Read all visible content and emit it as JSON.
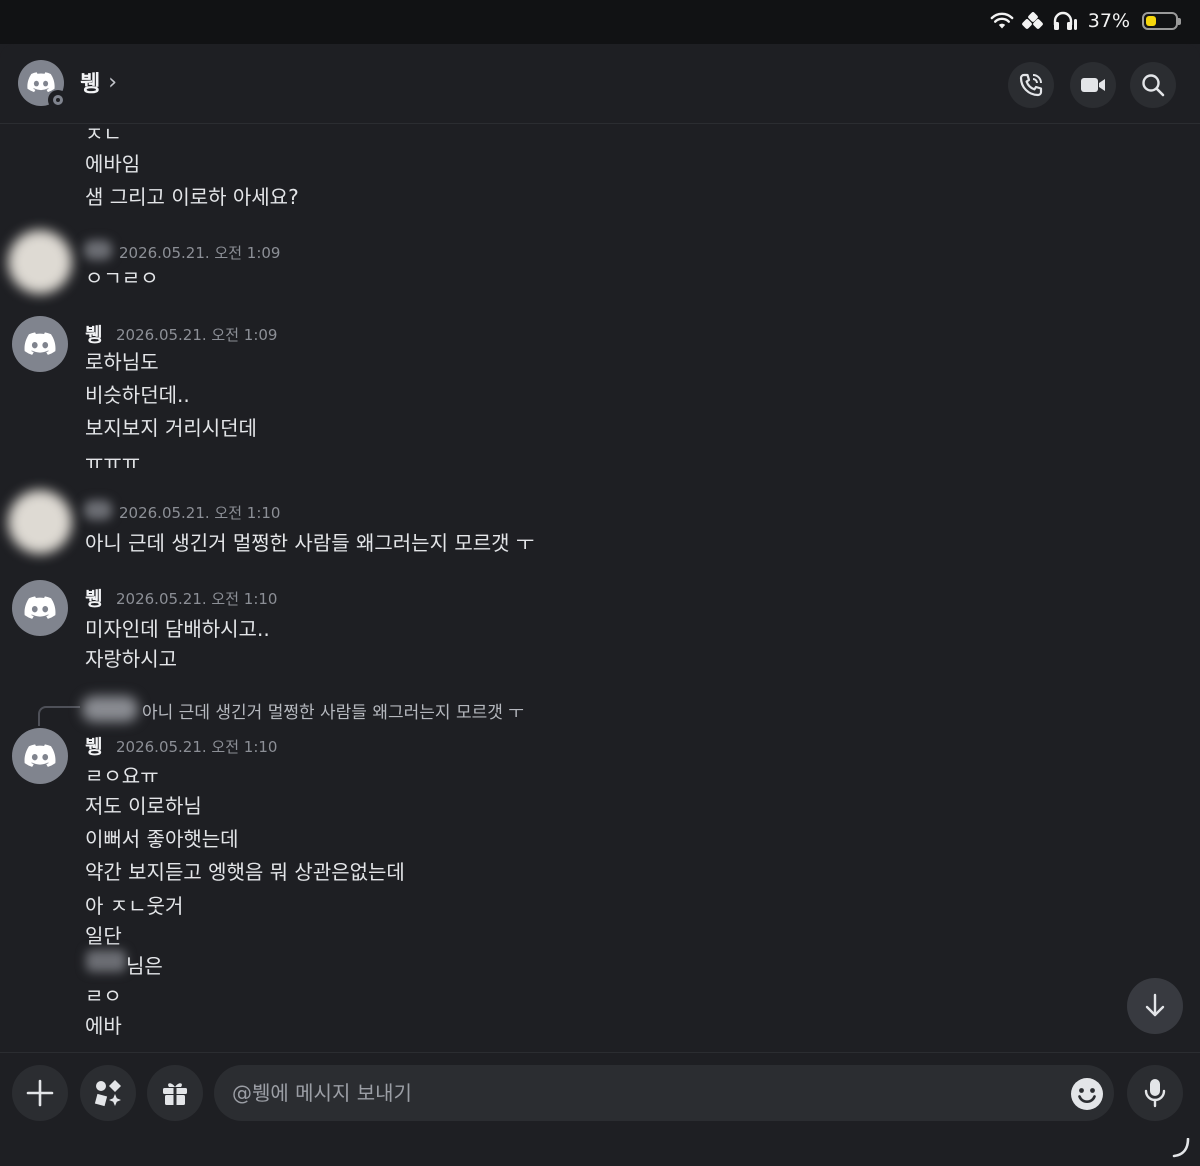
{
  "status_bar": {
    "battery_percent": "37%",
    "battery_level": 0.37,
    "battery_color": "#f5d60c",
    "icons": [
      "wifi-icon",
      "link-icon",
      "headphones-icon",
      "battery-icon"
    ]
  },
  "header": {
    "channel_name": "뷍",
    "chevron": "›",
    "buttons": [
      "voice-call-icon",
      "video-call-icon",
      "search-icon"
    ]
  },
  "messages": {
    "group0": {
      "lines": [
        "ㅈㄴ",
        "에바임",
        "샘 그리고 이로하 아세요?"
      ]
    },
    "group1": {
      "timestamp": "2026.05.21. 오전 1:09",
      "lines": [
        "ㅇㄱㄹㅇ"
      ]
    },
    "group2": {
      "author": "뷍",
      "timestamp": "2026.05.21. 오전 1:09",
      "lines": [
        "로하님도",
        "비슷하던데..",
        "보지보지 거리시던데",
        "ㅠㅠㅠ"
      ]
    },
    "group3": {
      "timestamp": "2026.05.21. 오전 1:10",
      "lines": [
        "아니 근데 생긴거 멀쩡한 사람들 왜그러는지 모르갯 ㅜ"
      ]
    },
    "group4": {
      "author": "뷍",
      "timestamp": "2026.05.21. 오전 1:10",
      "lines": [
        "미자인데 담배하시고..",
        "자랑하시고"
      ]
    },
    "group5": {
      "reply_preview": "아니 근데 생긴거 멀쩡한 사람들 왜그러는지 모르갯 ㅜ",
      "author": "뷍",
      "timestamp": "2026.05.21. 오전 1:10",
      "lines": [
        "ㄹㅇ요ㅠ",
        "저도 이로하님",
        "이뻐서 좋아햇는데",
        "약간 보지듣고 엥햇음 뭐 상관은없는데",
        "아 ㅈㄴ웃거",
        "일단",
        "님은",
        "ㄹㅇ",
        "에바"
      ]
    }
  },
  "composer": {
    "placeholder": "@뷍에 메시지 보내기",
    "value": "",
    "buttons": [
      "plus-icon",
      "apps-icon",
      "gift-icon",
      "emoji-icon",
      "microphone-icon"
    ]
  },
  "colors": {
    "background": "#1e1f23",
    "status_bar": "#111214",
    "avatar_gray": "#80848e",
    "button_bg": "#2b2d31",
    "text": "#e3e5e8",
    "muted": "#8c8f96"
  }
}
